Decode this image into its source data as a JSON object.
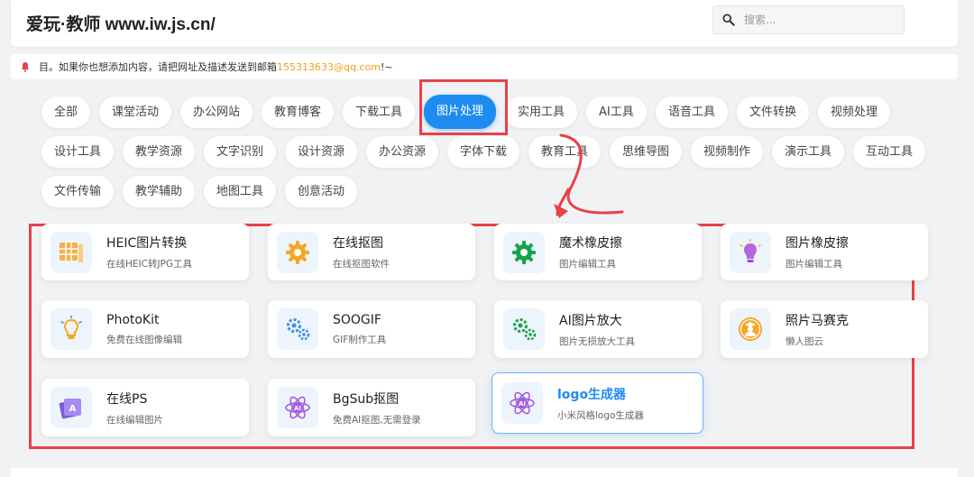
{
  "header": {
    "title": "爱玩·教师 www.iw.js.cn/",
    "search_placeholder": "搜索..."
  },
  "notice": {
    "text_before": "目。如果你也想添加内容，请把网址及描述发送到邮箱",
    "email": "155313633@qq.com",
    "text_after": "!~"
  },
  "tags": [
    {
      "label": "全部"
    },
    {
      "label": "课堂活动"
    },
    {
      "label": "办公网站"
    },
    {
      "label": "教育博客"
    },
    {
      "label": "下载工具"
    },
    {
      "label": "图片处理"
    },
    {
      "label": "实用工具"
    },
    {
      "label": "AI工具"
    },
    {
      "label": "语音工具"
    },
    {
      "label": "文件转换"
    },
    {
      "label": "视频处理"
    },
    {
      "label": "设计工具"
    },
    {
      "label": "教学资源"
    },
    {
      "label": "文字识别"
    },
    {
      "label": "设计资源"
    },
    {
      "label": "办公资源"
    },
    {
      "label": "字体下载"
    },
    {
      "label": "教育工具"
    },
    {
      "label": "思维导图"
    },
    {
      "label": "视频制作"
    },
    {
      "label": "演示工具"
    },
    {
      "label": "互动工具"
    },
    {
      "label": "文件传输"
    },
    {
      "label": "教学辅助"
    },
    {
      "label": "地图工具"
    },
    {
      "label": "创意活动"
    }
  ],
  "active_tag": "图片处理",
  "cards": [
    {
      "name": "HEIC图片转换",
      "desc": "在线HEIC转JPG工具",
      "icon": "grid-icon"
    },
    {
      "name": "在线抠图",
      "desc": "在线抠图软件",
      "icon": "gear-icon"
    },
    {
      "name": "魔术橡皮擦",
      "desc": "图片编辑工具",
      "icon": "gear-icon"
    },
    {
      "name": "图片橡皮擦",
      "desc": "图片编辑工具",
      "icon": "bulb-icon"
    },
    {
      "name": "PhotoKit",
      "desc": "免费在线图像编辑",
      "icon": "bulb-icon"
    },
    {
      "name": "SOOGIF",
      "desc": "GIF制作工具",
      "icon": "gears-icon"
    },
    {
      "name": "AI图片放大",
      "desc": "图片无损放大工具",
      "icon": "gears-icon"
    },
    {
      "name": "照片马赛克",
      "desc": "懒人图云",
      "icon": "user-badge-icon"
    },
    {
      "name": "在线PS",
      "desc": "在线编辑图片",
      "icon": "photo-stack-icon"
    },
    {
      "name": "BgSub抠图",
      "desc": "免费AI抠图,无需登录",
      "icon": "ai-atom-icon"
    },
    {
      "name": "logo生成器",
      "desc": "小米风格logo生成器",
      "icon": "ai-atom-icon"
    }
  ],
  "colors": {
    "accent": "#1e8bf0",
    "annotation_red": "#e84148",
    "email": "#f0a020"
  }
}
